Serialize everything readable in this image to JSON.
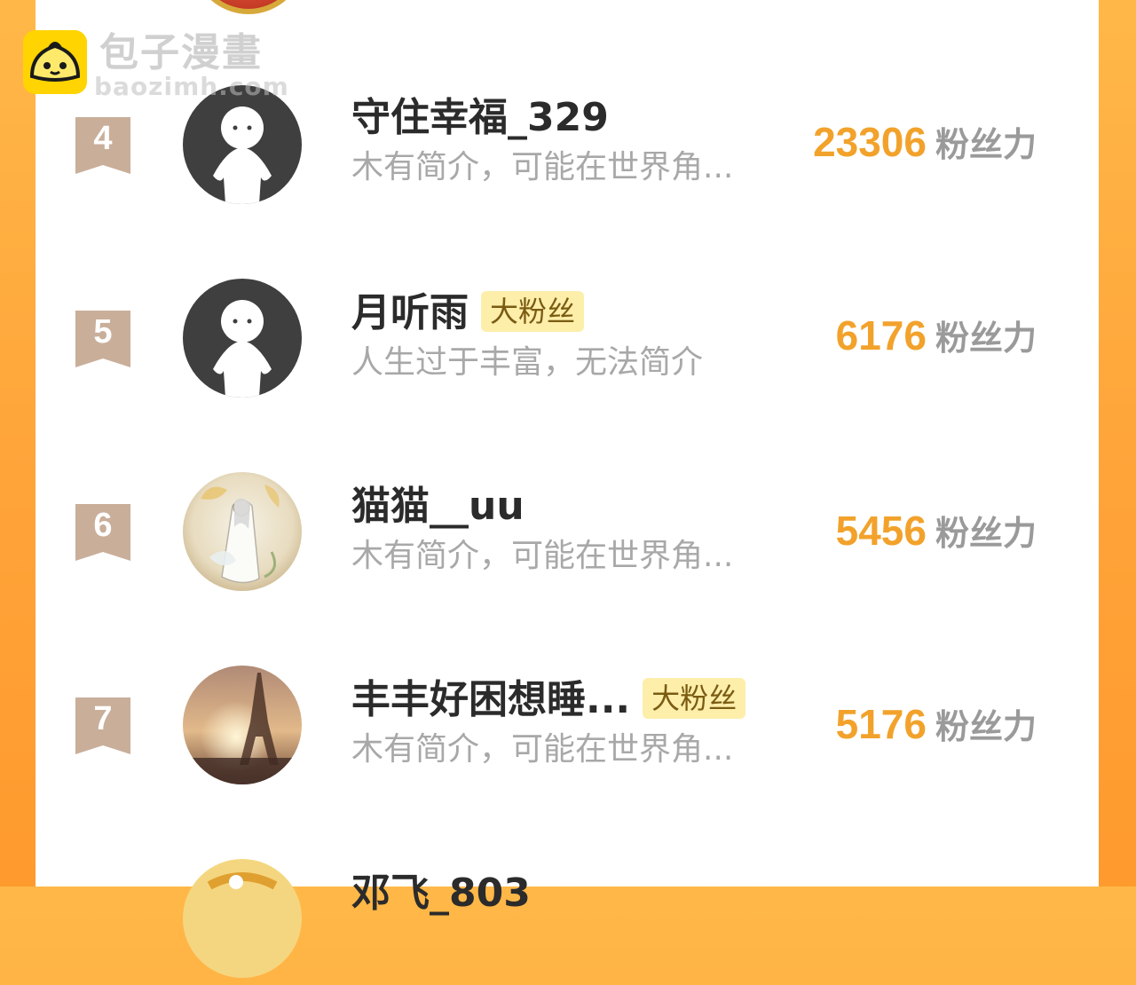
{
  "watermark": {
    "title": "包子漫畫",
    "subtitle": "baozimh.com"
  },
  "colors": {
    "background": "#ffa53a",
    "score": "#f2a22b",
    "rank_flag": "#c9ae9a",
    "badge_bg": "#fdeeaa",
    "badge_text": "#7a5b12"
  },
  "fans": [
    {
      "rank": "4",
      "name": "守住幸福_329",
      "badge": "",
      "bio": "木有简介，可能在世界角...",
      "score": "23306",
      "unit": "粉丝力",
      "avatar": "default-avatar-icon"
    },
    {
      "rank": "5",
      "name": "月听雨",
      "badge": "大粉丝",
      "bio": "人生过于丰富，无法简介",
      "score": "6176",
      "unit": "粉丝力",
      "avatar": "default-avatar-icon"
    },
    {
      "rank": "6",
      "name": "猫猫__uu",
      "badge": "",
      "bio": "木有简介，可能在世界角...",
      "score": "5456",
      "unit": "粉丝力",
      "avatar": "illustration-avatar"
    },
    {
      "rank": "7",
      "name": "丰丰好困想睡...",
      "badge": "大粉丝",
      "bio": "木有简介，可能在世界角...",
      "score": "5176",
      "unit": "粉丝力",
      "avatar": "eiffel-tower-avatar"
    },
    {
      "rank": "",
      "name": "邓飞_803",
      "badge": "",
      "bio": "",
      "score": "",
      "unit": "",
      "avatar": "partial-avatar"
    }
  ]
}
